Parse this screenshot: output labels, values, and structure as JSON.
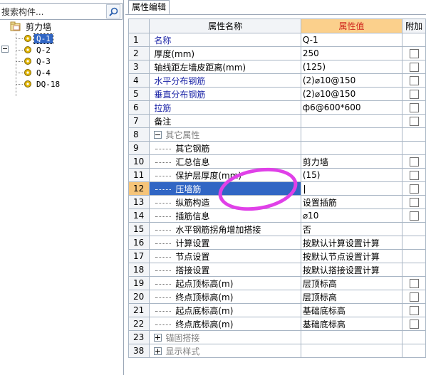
{
  "left_panel": {
    "search_placeholder": "搜索构件...",
    "tree": {
      "root_label": "剪力墙",
      "items": [
        {
          "label": "Q-1",
          "selected": true
        },
        {
          "label": "Q-2",
          "selected": false
        },
        {
          "label": "Q-3",
          "selected": false
        },
        {
          "label": "Q-4",
          "selected": false
        },
        {
          "label": "DQ-18",
          "selected": false
        }
      ]
    }
  },
  "right_panel": {
    "tab_label": "属性编辑",
    "headers": {
      "name": "属性名称",
      "value": "属性值",
      "extra": "附加"
    },
    "rows": [
      {
        "num": "1",
        "name": "名称",
        "value": "Q-1"
      },
      {
        "num": "2",
        "name": "厚度(mm)",
        "value": "250"
      },
      {
        "num": "3",
        "name": "轴线距左墙皮距离(mm)",
        "value": "(125)"
      },
      {
        "num": "4",
        "name": "水平分布钢筋",
        "value": "(2)⌀10@150"
      },
      {
        "num": "5",
        "name": "垂直分布钢筋",
        "value": "(2)⌀10@150"
      },
      {
        "num": "6",
        "name": "拉筋",
        "value": "ф6@600*600"
      },
      {
        "num": "7",
        "name": "备注",
        "value": ""
      },
      {
        "num": "8",
        "name": "其它属性",
        "value": ""
      },
      {
        "num": "9",
        "name": "其它钢筋",
        "value": ""
      },
      {
        "num": "10",
        "name": "汇总信息",
        "value": "剪力墙"
      },
      {
        "num": "11",
        "name": "保护层厚度(mm)",
        "value": "(15)"
      },
      {
        "num": "12",
        "name": "压墙筋",
        "value": ""
      },
      {
        "num": "13",
        "name": "纵筋构造",
        "value": "设置插筋"
      },
      {
        "num": "14",
        "name": "插筋信息",
        "value": "⌀10"
      },
      {
        "num": "15",
        "name": "水平钢筋拐角增加搭接",
        "value": "否"
      },
      {
        "num": "16",
        "name": "计算设置",
        "value": "按默认计算设置计算"
      },
      {
        "num": "17",
        "name": "节点设置",
        "value": "按默认节点设置计算"
      },
      {
        "num": "18",
        "name": "搭接设置",
        "value": "按默认搭接设置计算"
      },
      {
        "num": "19",
        "name": "起点顶标高(m)",
        "value": "层顶标高"
      },
      {
        "num": "20",
        "name": "终点顶标高(m)",
        "value": "层顶标高"
      },
      {
        "num": "21",
        "name": "起点底标高(m)",
        "value": "基础底标高"
      },
      {
        "num": "22",
        "name": "终点底标高(m)",
        "value": "基础底标高"
      },
      {
        "num": "23",
        "name": "锚固搭接",
        "value": ""
      },
      {
        "num": "38",
        "name": "显示样式",
        "value": ""
      }
    ]
  },
  "colors": {
    "selection": "#3166c4",
    "header_value_bg": "#fbd08c",
    "header_value_text": "#d0261e",
    "annotation_circle": "#e040e8"
  }
}
